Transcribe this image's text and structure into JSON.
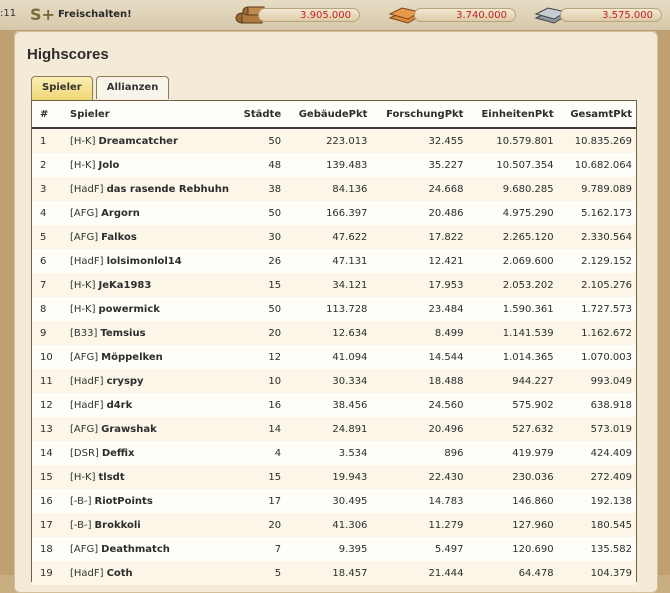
{
  "topbar": {
    "timer": ":11",
    "unlock_label": "Freischalten!",
    "resources": [
      {
        "name": "wood-icon",
        "value": "3.905.000"
      },
      {
        "name": "brick-icon",
        "value": "3.740.000"
      },
      {
        "name": "metal-icon",
        "value": "3.575.000"
      }
    ]
  },
  "page": {
    "title": "Highscores",
    "tabs": [
      {
        "label": "Spieler",
        "active": true
      },
      {
        "label": "Allianzen",
        "active": false
      }
    ]
  },
  "table": {
    "headers": [
      "#",
      "Spieler",
      "Städte",
      "GebäudePkt",
      "ForschungPkt",
      "EinheitenPkt",
      "GesamtPkt"
    ],
    "rows": [
      {
        "rank": "1",
        "tag": "[H-K]",
        "name": "Dreamcatcher",
        "cities": "50",
        "buildings": "223.013",
        "research": "32.455",
        "units": "10.579.801",
        "total": "10.835.269"
      },
      {
        "rank": "2",
        "tag": "[H-K]",
        "name": "Jolo",
        "cities": "48",
        "buildings": "139.483",
        "research": "35.227",
        "units": "10.507.354",
        "total": "10.682.064"
      },
      {
        "rank": "3",
        "tag": "[HadF]",
        "name": "das rasende Rebhuhn",
        "cities": "38",
        "buildings": "84.136",
        "research": "24.668",
        "units": "9.680.285",
        "total": "9.789.089"
      },
      {
        "rank": "4",
        "tag": "[AFG]",
        "name": "Argorn",
        "cities": "50",
        "buildings": "166.397",
        "research": "20.486",
        "units": "4.975.290",
        "total": "5.162.173"
      },
      {
        "rank": "5",
        "tag": "[AFG]",
        "name": "Falkos",
        "cities": "30",
        "buildings": "47.622",
        "research": "17.822",
        "units": "2.265.120",
        "total": "2.330.564"
      },
      {
        "rank": "6",
        "tag": "[HadF]",
        "name": "lolsimonlol14",
        "cities": "26",
        "buildings": "47.131",
        "research": "12.421",
        "units": "2.069.600",
        "total": "2.129.152"
      },
      {
        "rank": "7",
        "tag": "[H-K]",
        "name": "JeKa1983",
        "cities": "15",
        "buildings": "34.121",
        "research": "17.953",
        "units": "2.053.202",
        "total": "2.105.276"
      },
      {
        "rank": "8",
        "tag": "[H-K]",
        "name": "powermick",
        "cities": "50",
        "buildings": "113.728",
        "research": "23.484",
        "units": "1.590.361",
        "total": "1.727.573"
      },
      {
        "rank": "9",
        "tag": "[B33]",
        "name": "Temsius",
        "cities": "20",
        "buildings": "12.634",
        "research": "8.499",
        "units": "1.141.539",
        "total": "1.162.672"
      },
      {
        "rank": "10",
        "tag": "[AFG]",
        "name": "Möppelken",
        "cities": "12",
        "buildings": "41.094",
        "research": "14.544",
        "units": "1.014.365",
        "total": "1.070.003"
      },
      {
        "rank": "11",
        "tag": "[HadF]",
        "name": "cryspy",
        "cities": "10",
        "buildings": "30.334",
        "research": "18.488",
        "units": "944.227",
        "total": "993.049"
      },
      {
        "rank": "12",
        "tag": "[HadF]",
        "name": "d4rk",
        "cities": "16",
        "buildings": "38.456",
        "research": "24.560",
        "units": "575.902",
        "total": "638.918"
      },
      {
        "rank": "13",
        "tag": "[AFG]",
        "name": "Grawshak",
        "cities": "14",
        "buildings": "24.891",
        "research": "20.496",
        "units": "527.632",
        "total": "573.019"
      },
      {
        "rank": "14",
        "tag": "[DSR]",
        "name": "Deffix",
        "cities": "4",
        "buildings": "3.534",
        "research": "896",
        "units": "419.979",
        "total": "424.409"
      },
      {
        "rank": "15",
        "tag": "[H-K]",
        "name": "tlsdt",
        "cities": "15",
        "buildings": "19.943",
        "research": "22.430",
        "units": "230.036",
        "total": "272.409"
      },
      {
        "rank": "16",
        "tag": "[-B-]",
        "name": "RiotPoints",
        "cities": "17",
        "buildings": "30.495",
        "research": "14.783",
        "units": "146.860",
        "total": "192.138"
      },
      {
        "rank": "17",
        "tag": "[-B-]",
        "name": "Brokkoli",
        "cities": "20",
        "buildings": "41.306",
        "research": "11.279",
        "units": "127.960",
        "total": "180.545"
      },
      {
        "rank": "18",
        "tag": "[AFG]",
        "name": "Deathmatch",
        "cities": "7",
        "buildings": "9.395",
        "research": "5.497",
        "units": "120.690",
        "total": "135.582"
      },
      {
        "rank": "19",
        "tag": "[HadF]",
        "name": "Coth",
        "cities": "5",
        "buildings": "18.457",
        "research": "21.444",
        "units": "64.478",
        "total": "104.379"
      }
    ]
  }
}
